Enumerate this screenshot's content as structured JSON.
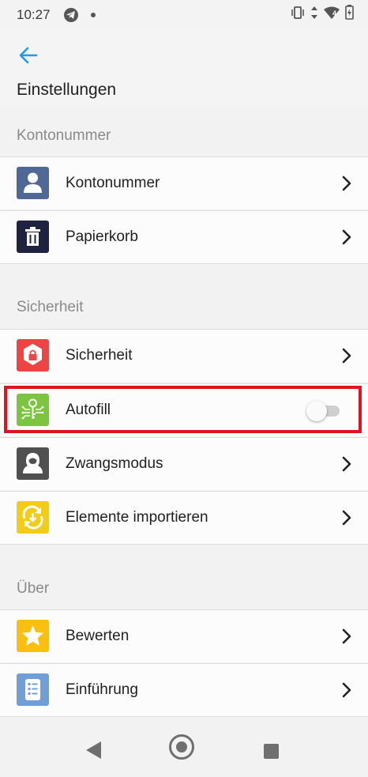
{
  "status_bar": {
    "time": "10:27",
    "battery_label": "4"
  },
  "appbar": {
    "title": "Einstellungen"
  },
  "sections": {
    "account": {
      "header": "Kontonummer",
      "items": [
        {
          "label": "Kontonummer"
        },
        {
          "label": "Papierkorb"
        }
      ]
    },
    "security": {
      "header": "Sicherheit",
      "items": [
        {
          "label": "Sicherheit"
        },
        {
          "label": "Autofill",
          "toggle_on": false
        },
        {
          "label": "Zwangsmodus"
        },
        {
          "label": "Elemente importieren"
        }
      ]
    },
    "about": {
      "header": "Über",
      "items": [
        {
          "label": "Bewerten"
        },
        {
          "label": "Einführung"
        }
      ]
    }
  },
  "colors": {
    "accent": "#1e9be9",
    "highlight": "#e0141e",
    "icon_account": "#4f6895",
    "icon_trash": "#1f2340",
    "icon_security": "#ef4444",
    "icon_autofill": "#7cc540",
    "icon_duress": "#505050",
    "icon_import": "#f2cc17",
    "icon_rate": "#fbbf0f",
    "icon_intro": "#6f9fd6"
  },
  "icons": [
    "telegram-icon",
    "vibrate-icon",
    "wifi-icon",
    "battery-icon",
    "back-arrow-icon",
    "user-icon",
    "trash-icon",
    "lock-shield-icon",
    "circuit-key-icon",
    "hooded-figure-icon",
    "import-refresh-icon",
    "star-icon",
    "document-list-icon",
    "chevron-right-icon"
  ]
}
